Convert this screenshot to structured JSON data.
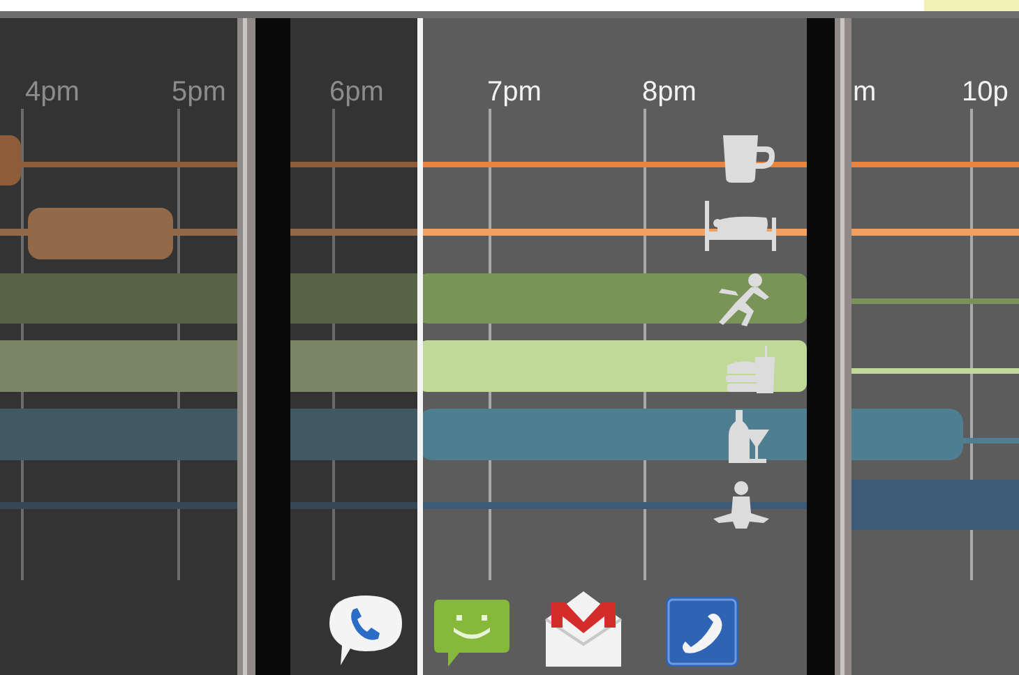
{
  "screens": [
    {
      "dimmed": true,
      "hours": [
        "4pm",
        "5pm"
      ]
    },
    {
      "dimmed": true,
      "hours": [
        "6pm"
      ]
    },
    {
      "dimmed": false,
      "hours": [
        "7pm",
        "8pm"
      ]
    },
    {
      "dimmed": false,
      "hours": [
        "m",
        "10p"
      ]
    }
  ],
  "lanes": [
    {
      "kind": "coffee",
      "color": "#e8843f"
    },
    {
      "kind": "sleep",
      "color": "#f0a060"
    },
    {
      "kind": "exercise",
      "color": "#7a9457"
    },
    {
      "kind": "food",
      "color": "#c0d898"
    },
    {
      "kind": "drink",
      "color": "#4d7f91"
    },
    {
      "kind": "meditation",
      "color": "#3d5a78"
    }
  ],
  "dock": [
    {
      "kind": "voice"
    },
    {
      "kind": "messaging"
    },
    {
      "kind": "mail"
    },
    {
      "kind": "phone"
    }
  ]
}
